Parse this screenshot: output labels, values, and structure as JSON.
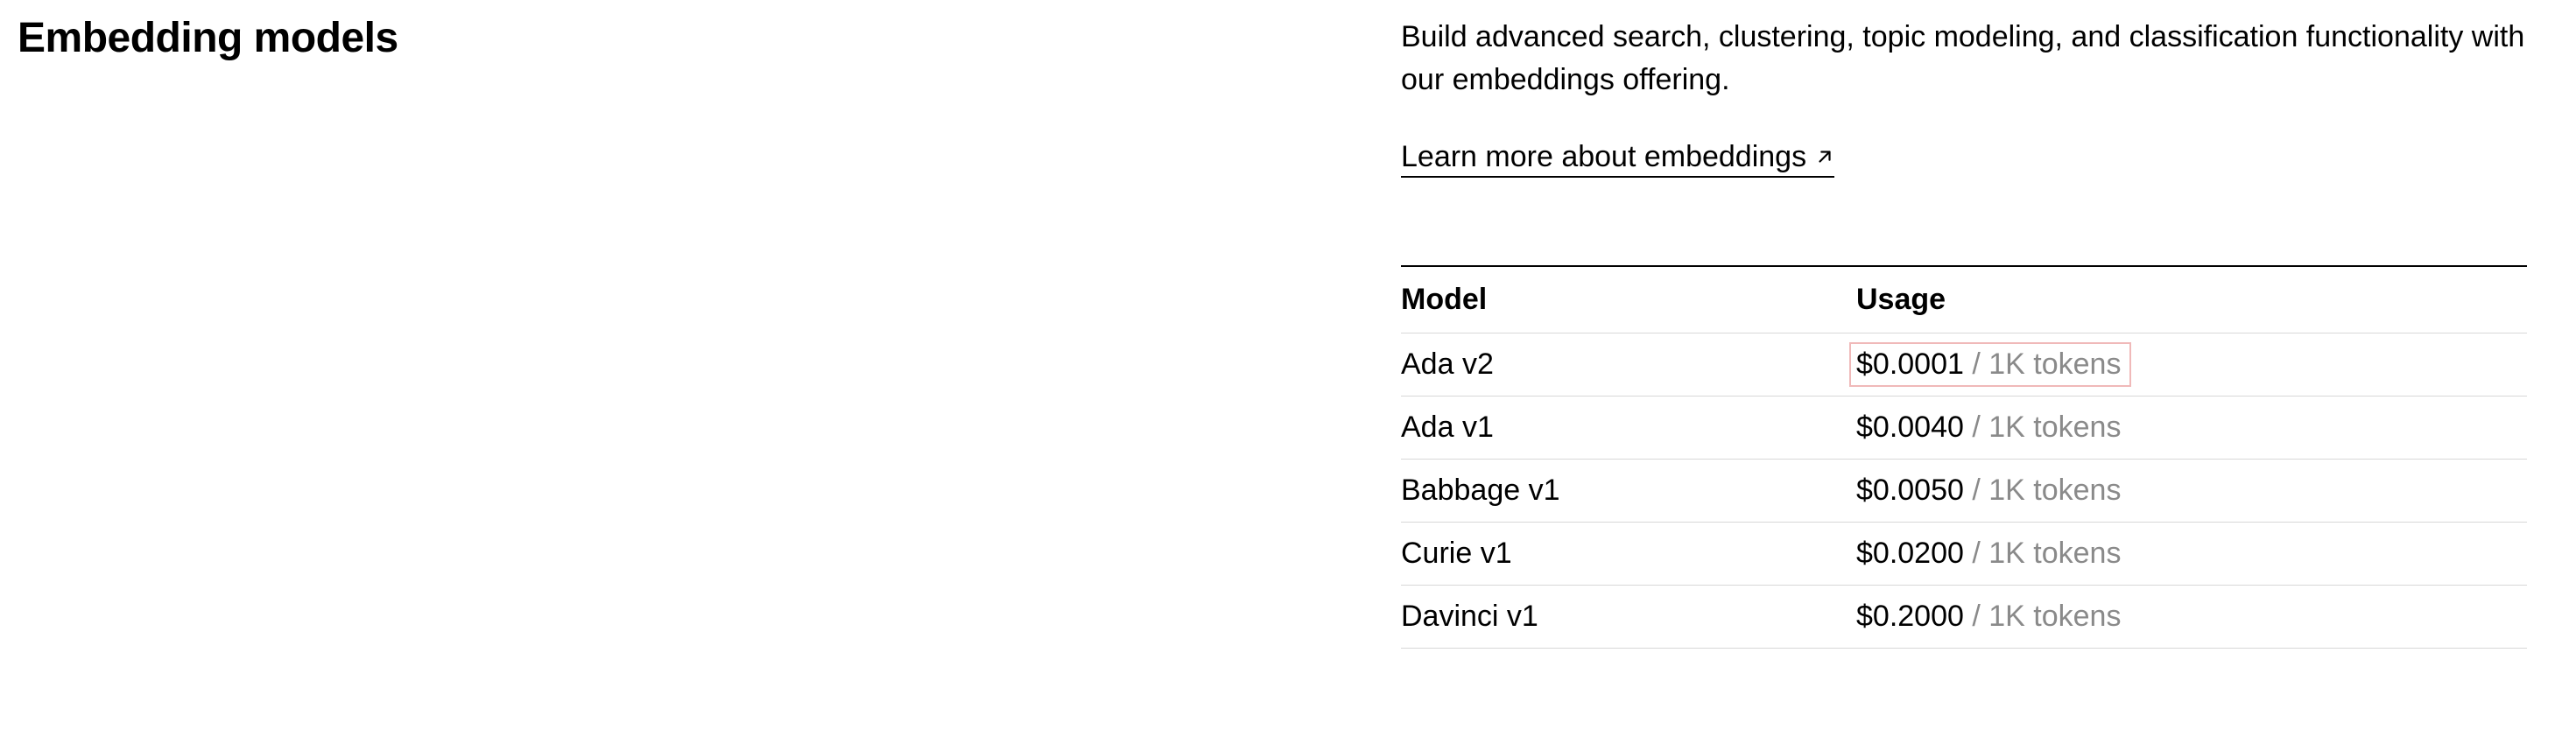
{
  "header": {
    "title": "Embedding models"
  },
  "content": {
    "description": "Build advanced search, clustering, topic modeling, and classification functionality with our embeddings offering.",
    "learn_more_label": "Learn more about embeddings"
  },
  "table": {
    "col_model": "Model",
    "col_usage": "Usage",
    "rows": [
      {
        "model": "Ada v2",
        "price": "$0.0001",
        "unit": " / 1K tokens",
        "highlight": true
      },
      {
        "model": "Ada v1",
        "price": "$0.0040",
        "unit": " / 1K tokens",
        "highlight": false
      },
      {
        "model": "Babbage v1",
        "price": "$0.0050",
        "unit": " / 1K tokens",
        "highlight": false
      },
      {
        "model": "Curie v1",
        "price": "$0.0200",
        "unit": " / 1K tokens",
        "highlight": false
      },
      {
        "model": "Davinci v1",
        "price": "$0.2000",
        "unit": " / 1K tokens",
        "highlight": false
      }
    ]
  }
}
